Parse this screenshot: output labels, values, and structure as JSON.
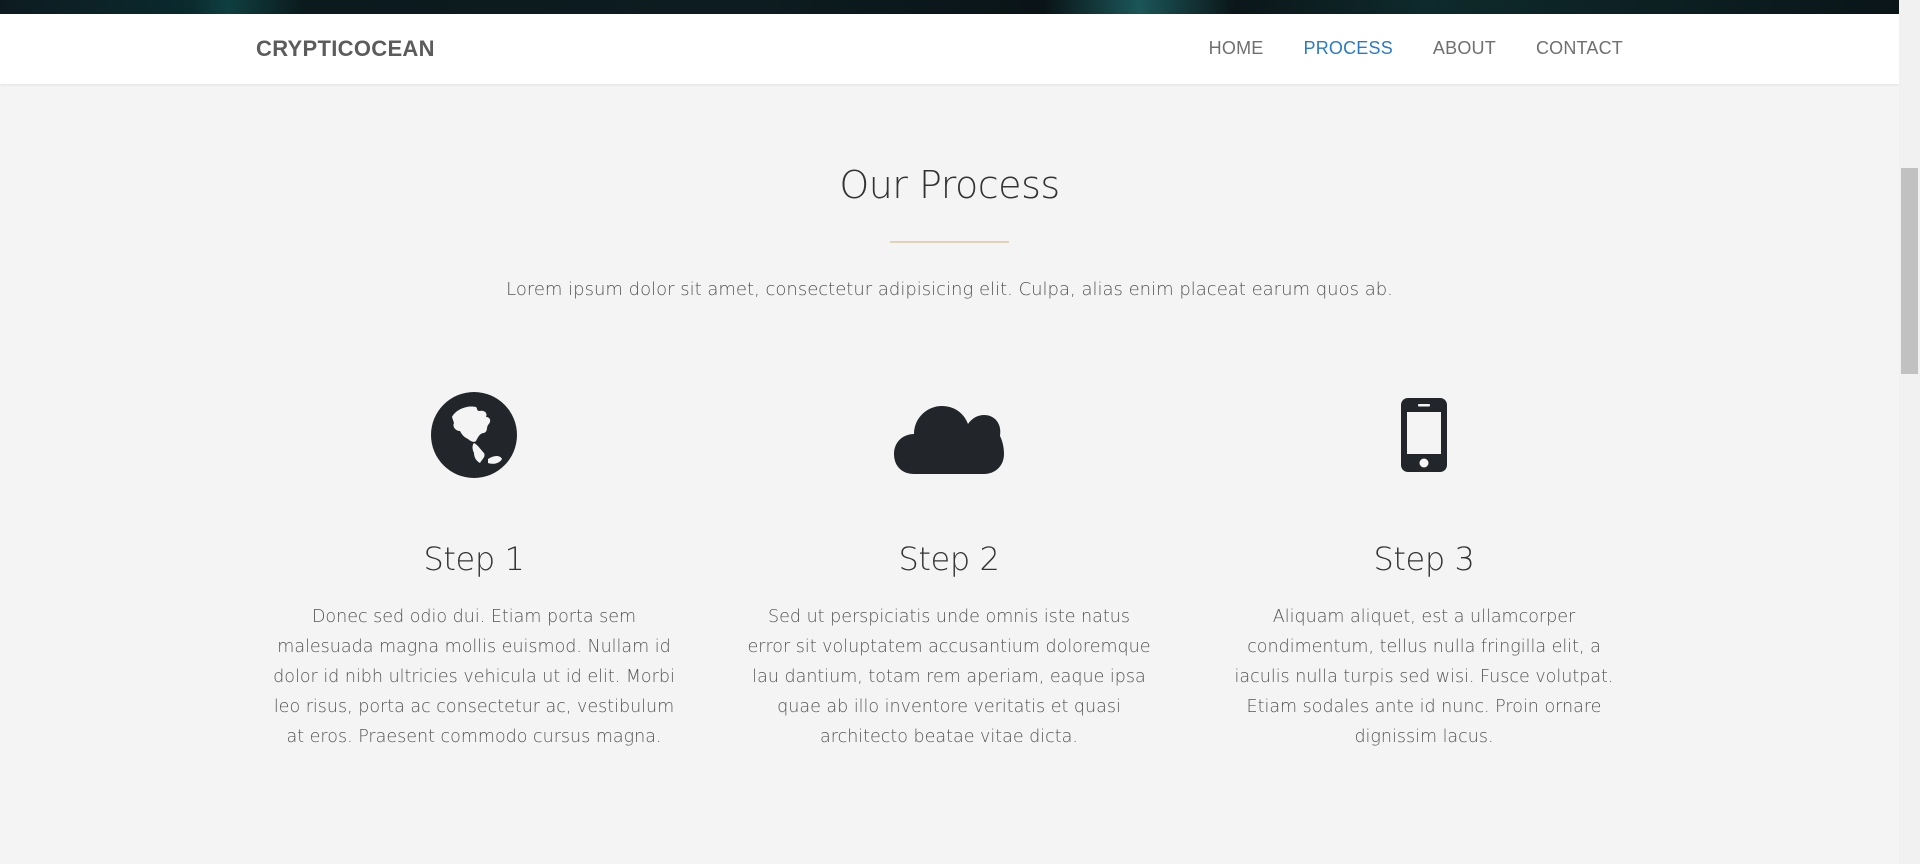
{
  "brand": "CRYPTICOCEAN",
  "nav": [
    {
      "label": "HOME",
      "active": false
    },
    {
      "label": "PROCESS",
      "active": true
    },
    {
      "label": "ABOUT",
      "active": false
    },
    {
      "label": "CONTACT",
      "active": false
    }
  ],
  "colors": {
    "accent": "#2a7ac7",
    "icon": "#22262a",
    "divider": "#e2d2b8",
    "background": "#f4f4f4"
  },
  "section": {
    "title": "Our Process",
    "lead": "Lorem ipsum dolor sit amet, consectetur adipisicing elit. Culpa, alias enim placeat earum quos ab."
  },
  "steps": [
    {
      "icon": "globe-icon",
      "title": "Step 1",
      "text": "Donec sed odio dui. Etiam porta sem malesuada magna mollis euismod. Nullam id dolor id nibh ultricies vehicula ut id elit. Morbi leo risus, porta ac consectetur ac, vestibulum at eros. Praesent commodo cursus magna."
    },
    {
      "icon": "cloud-icon",
      "title": "Step 2",
      "text": "Sed ut perspiciatis unde omnis iste natus error sit voluptatem accusantium doloremque lau dantium, totam rem aperiam, eaque ipsa quae ab illo inventore veritatis et quasi architecto beatae vitae dicta."
    },
    {
      "icon": "mobile-phone-icon",
      "title": "Step 3",
      "text": "Aliquam aliquet, est a ullamcorper condimentum, tellus nulla fringilla elit, a iaculis nulla turpis sed wisi. Fusce volutpat. Etiam sodales ante id nunc. Proin ornare dignissim lacus."
    }
  ]
}
